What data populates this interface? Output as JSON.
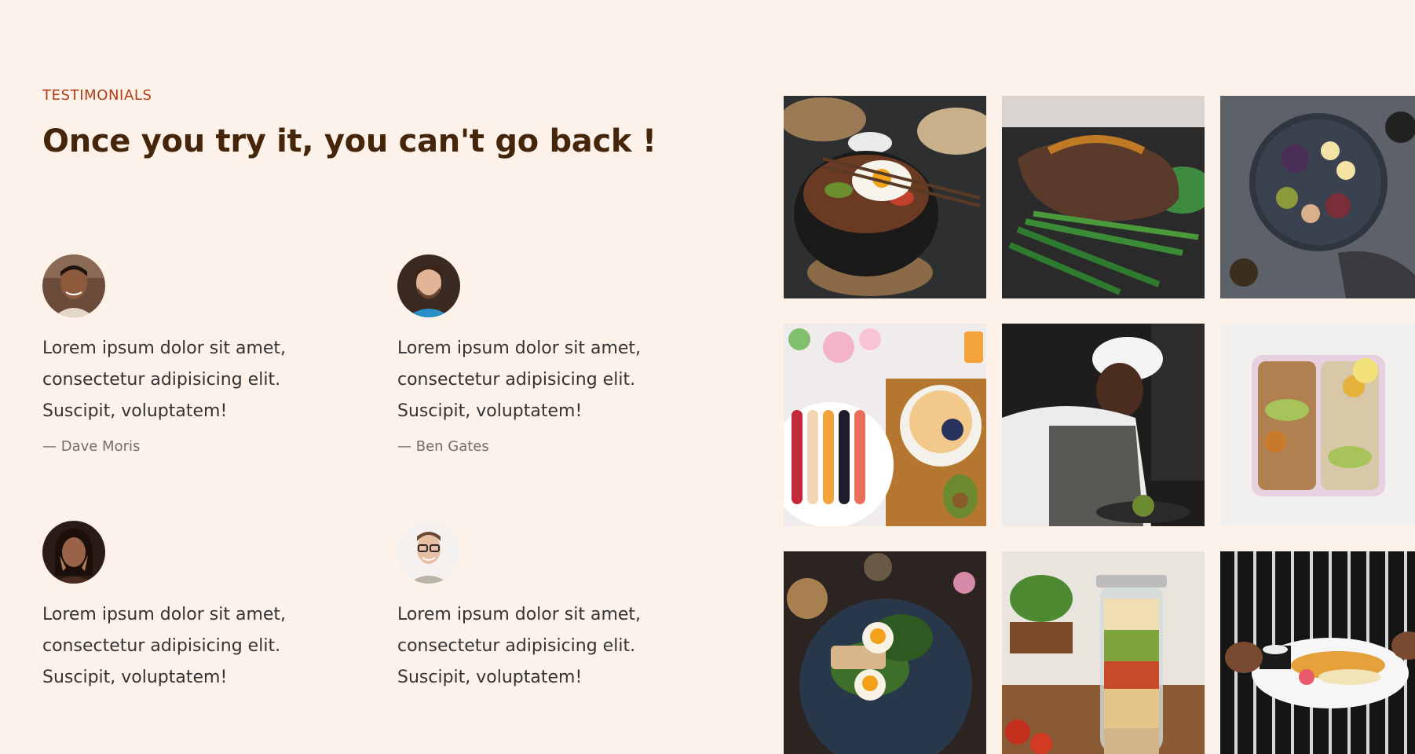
{
  "section": {
    "subheading": "TESTIMONIALS",
    "heading": "Once you try it, you can't go back !"
  },
  "testimonials": [
    {
      "quote_lines": [
        "Lorem ipsum dolor sit amet,",
        "consectetur adipisicing elit.",
        "Suscipit, voluptatem!"
      ],
      "author": "— Dave Moris"
    },
    {
      "quote_lines": [
        "Lorem ipsum dolor sit amet,",
        "consectetur adipisicing elit.",
        "Suscipit, voluptatem!"
      ],
      "author": "— Ben Gates"
    },
    {
      "quote_lines": [
        "Lorem ipsum dolor sit amet,",
        "consectetur adipisicing elit.",
        "Suscipit, voluptatem!"
      ],
      "author": ""
    },
    {
      "quote_lines": [
        "Lorem ipsum dolor sit amet,",
        "consectetur adipisicing elit.",
        "Suscipit, voluptatem!"
      ],
      "author": ""
    }
  ],
  "colors": {
    "background": "#fdf2e9",
    "accent": "#b23a13",
    "heading": "#45260a"
  },
  "gallery_icons": [
    "bibimbap-photo",
    "steak-photo",
    "platter-photo",
    "fruit-bowl-photo",
    "chef-photo",
    "meal-prep-photo",
    "salad-plate-photo",
    "jar-salad-photo",
    "served-plate-photo"
  ]
}
